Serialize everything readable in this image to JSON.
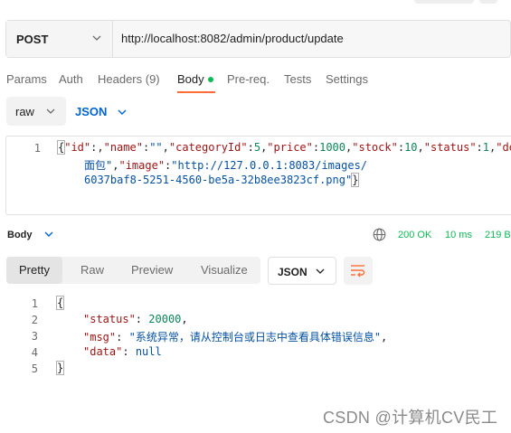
{
  "request": {
    "method": "POST",
    "url": "http://localhost:8082/admin/product/update"
  },
  "tabs": [
    {
      "label": "Params"
    },
    {
      "label": "Auth"
    },
    {
      "label": "Headers (9)"
    },
    {
      "label": "Body"
    },
    {
      "label": "Pre-req."
    },
    {
      "label": "Tests"
    },
    {
      "label": "Settings"
    }
  ],
  "body_mode": {
    "type": "raw",
    "language": "JSON"
  },
  "request_body": {
    "line_numbers": [
      "1"
    ],
    "tokens": [
      "{",
      "\"id\"",
      ":",
      ",",
      "\"name\"",
      ":",
      "\"\"",
      ",",
      "\"categoryId\"",
      ":",
      "5",
      ",",
      "\"price\"",
      ":",
      "1000",
      ",",
      "\"stock\"",
      ":",
      "10",
      ",",
      "\"status\"",
      ":",
      "1",
      ",",
      "\"de",
      "面包\"",
      ",",
      "\"image\"",
      ":",
      "\"http://127.0.0.1:8083/images/",
      "6037baf8-5251-4560-be5a-32b8ee3823cf.png\"",
      "}"
    ]
  },
  "response": {
    "section_label": "Body",
    "status": "200 OK",
    "time": "10 ms",
    "size": "219 B",
    "views": [
      "Pretty",
      "Raw",
      "Preview",
      "Visualize"
    ],
    "format": "JSON",
    "line_numbers": [
      "1",
      "2",
      "3",
      "4",
      "5"
    ],
    "tokens": [
      "{",
      "\"status\"",
      ":",
      "20000",
      ",",
      "\"msg\"",
      ":",
      "\"系统异常，请从控制台或日志中查看具体错误信息\"",
      ",",
      "\"data\"",
      ":",
      "null",
      "}"
    ]
  },
  "watermark": "CSDN @计算机CV民工",
  "colors": {
    "accent": "#ff6c37",
    "status_green": "#0cbb52",
    "link_blue": "#0265d2",
    "json_key": "#a31515",
    "json_string": "#0451a5",
    "json_number": "#098658"
  }
}
